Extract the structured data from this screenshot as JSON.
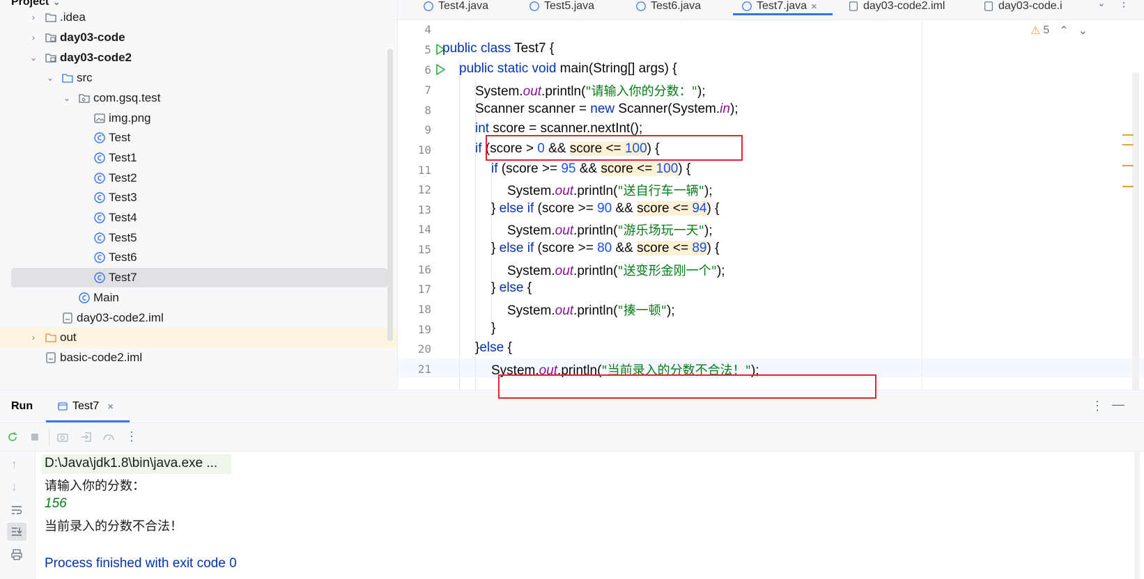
{
  "project": {
    "header": "Project",
    "items": [
      {
        "label": ".idea"
      },
      {
        "label": "day03-code"
      },
      {
        "label": "day03-code2"
      },
      {
        "label": "src"
      },
      {
        "label": "com.gsq.test"
      },
      {
        "label": "img.png"
      },
      {
        "label": "Test"
      },
      {
        "label": "Test1"
      },
      {
        "label": "Test2"
      },
      {
        "label": "Test3"
      },
      {
        "label": "Test4"
      },
      {
        "label": "Test5"
      },
      {
        "label": "Test6"
      },
      {
        "label": "Test7"
      },
      {
        "label": "Main"
      },
      {
        "label": "day03-code2.iml"
      },
      {
        "label": "out"
      },
      {
        "label": "basic-code2.iml"
      }
    ]
  },
  "tabs": [
    {
      "label": "Test4.java"
    },
    {
      "label": "Test5.java"
    },
    {
      "label": "Test6.java"
    },
    {
      "label": "Test7.java",
      "close": "×"
    },
    {
      "label": "day03-code2.iml"
    },
    {
      "label": "day03-code.i"
    }
  ],
  "editor": {
    "warnings": "5",
    "line_numbers": [
      "4",
      "5",
      "6",
      "7",
      "8",
      "9",
      "10",
      "11",
      "12",
      "13",
      "14",
      "15",
      "16",
      "17",
      "18",
      "19",
      "20",
      "21"
    ],
    "lines": {
      "l5": {
        "a": "public class",
        "b": " Test7 {"
      },
      "l6": {
        "a": "public static void",
        "b": " main(String[] args) {"
      },
      "l7": {
        "a": "System.",
        "b": "out",
        "c": ".println(",
        "d": "\"请输入你的分数：\"",
        "e": ");"
      },
      "l8": {
        "a": "Scanner scanner = ",
        "b": "new",
        "c": " Scanner(System.",
        "d": "in",
        "e": ");"
      },
      "l9": {
        "a": "int",
        "b": " score = scanner.nextInt();"
      },
      "l10": {
        "a": "if",
        "b": " (score > ",
        "c": "0",
        "d": " && ",
        "e": "score",
        "f": " <= ",
        "g": "100",
        "h": ") {"
      },
      "l11": {
        "a": "if",
        "b": " (score >= ",
        "c": "95",
        "d": " && ",
        "e": "score",
        "f": " <= ",
        "g": "100",
        "h": ") {"
      },
      "l12": {
        "a": "System.",
        "b": "out",
        "c": ".println(",
        "d": "\"送自行车一辆\"",
        "e": ");"
      },
      "l13": {
        "a": "} ",
        "b": "else if",
        "c": " (score >= ",
        "d": "90",
        "e": " && ",
        "f": "score",
        "g": " <= ",
        "h": "94",
        "i": ") {"
      },
      "l14": {
        "a": "System.",
        "b": "out",
        "c": ".println(",
        "d": "\"游乐场玩一天\"",
        "e": ");"
      },
      "l15": {
        "a": "} ",
        "b": "else if",
        "c": " (score >= ",
        "d": "80",
        "e": " && ",
        "f": "score",
        "g": " <= ",
        "h": "89",
        "i": ") {"
      },
      "l16": {
        "a": "System.",
        "b": "out",
        "c": ".println(",
        "d": "\"送变形金刚一个\"",
        "e": ");"
      },
      "l17": {
        "a": "} ",
        "b": "else",
        "c": " {"
      },
      "l18": {
        "a": "System.",
        "b": "out",
        "c": ".println(",
        "d": "\"揍一顿\"",
        "e": ");"
      },
      "l19": {
        "a": "}"
      },
      "l20": {
        "a": "}",
        "b": "else",
        "c": " {"
      },
      "l21": {
        "a": "System.",
        "b": "out",
        "c": ".println(",
        "d": "\"当前录入的分数不合法！\"",
        "e": ");"
      }
    }
  },
  "run": {
    "title": "Run",
    "tab": "Test7",
    "tab_close": "×",
    "console": [
      "D:\\Java\\jdk1.8\\bin\\java.exe ...",
      "请输入你的分数：",
      "156",
      "当前录入的分数不合法！",
      "",
      "Process finished with exit code 0"
    ]
  },
  "colors": {
    "keyword": "#0033b3",
    "number": "#1750eb",
    "string": "#067d17",
    "field": "#871094",
    "accent": "#3574f0",
    "annotation_box": "#e0262e"
  }
}
